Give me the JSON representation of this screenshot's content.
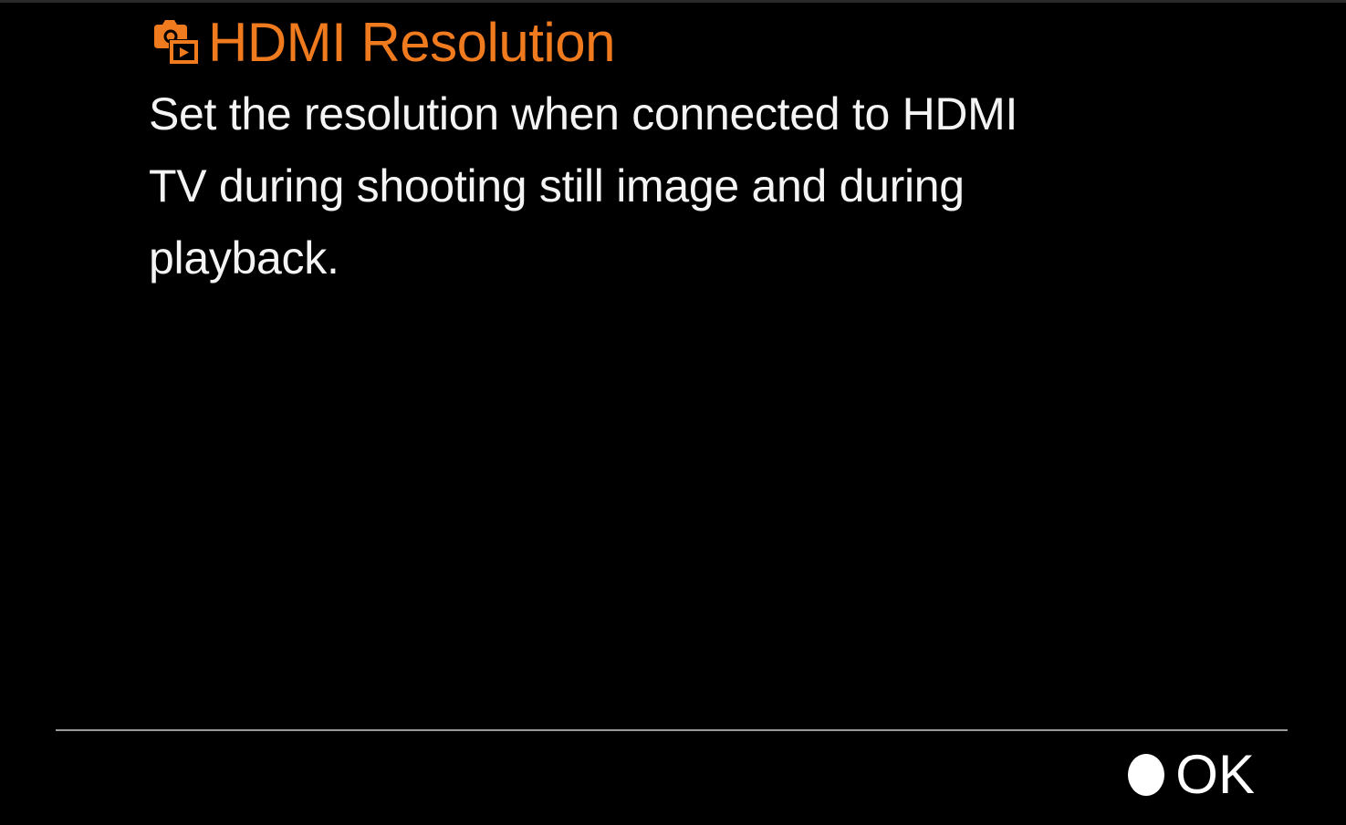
{
  "header": {
    "icon": "camera-playback-icon",
    "title": "HDMI Resolution"
  },
  "description": {
    "text": "Set the resolution when connected to HDMI TV during shooting still image and during playback."
  },
  "footer": {
    "ok_icon": "center-button-dot-icon",
    "ok_label": "OK"
  },
  "colors": {
    "accent": "#f07a1e",
    "background": "#000000",
    "text": "#ffffff",
    "divider": "#9a9a9a"
  }
}
